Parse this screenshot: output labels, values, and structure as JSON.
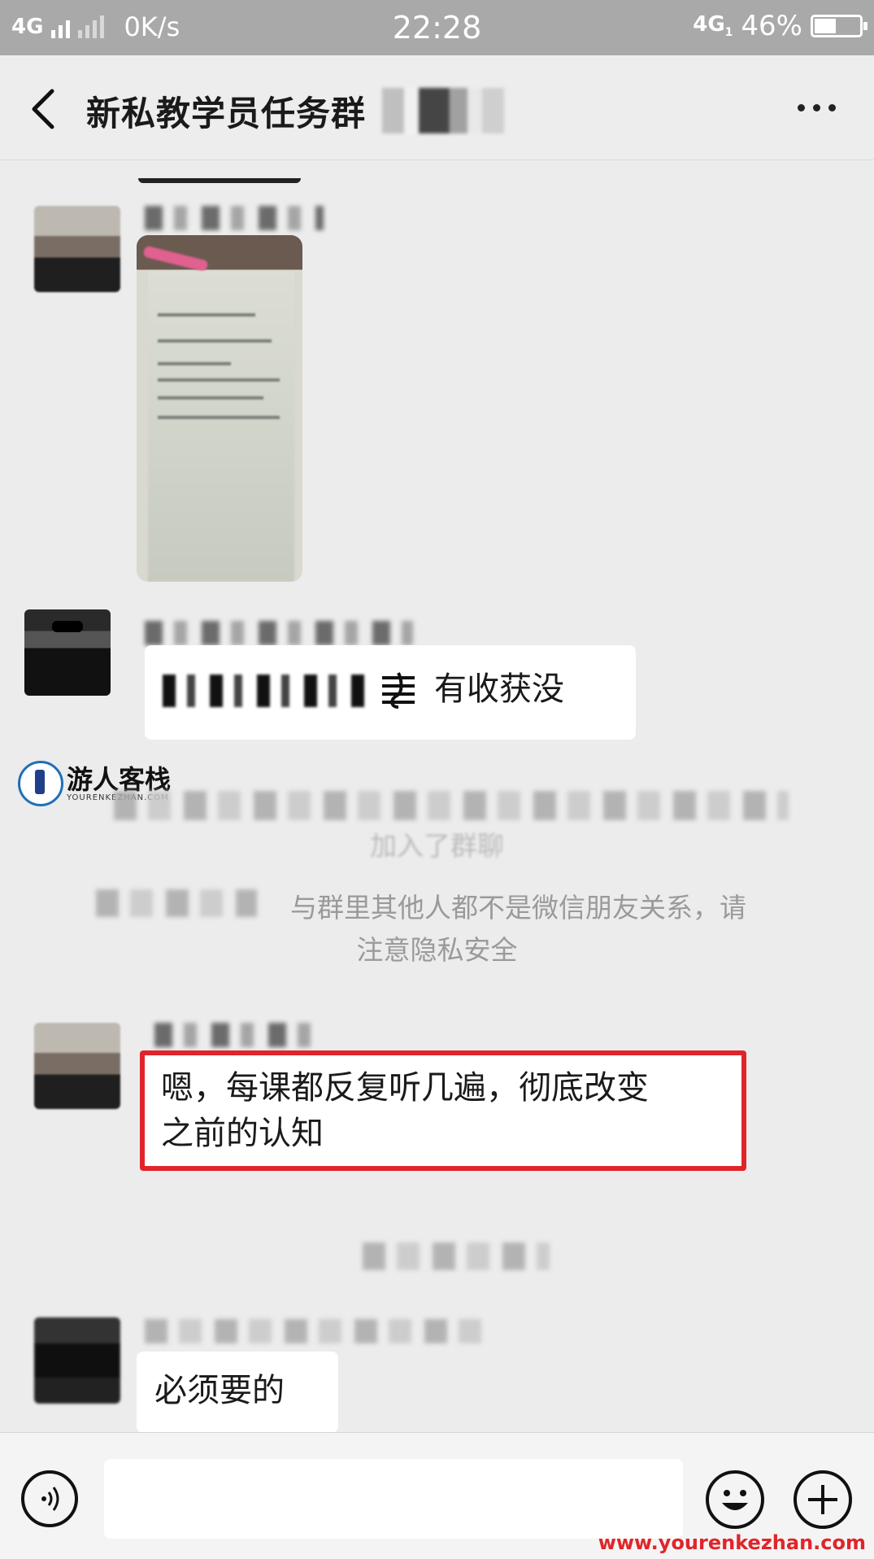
{
  "status_bar": {
    "network_left": "4G",
    "speed": "0K/s",
    "time": "22:28",
    "network_right": "4G",
    "network_right_sub": "1",
    "battery": "46%"
  },
  "nav": {
    "title": "新私教学员任务群"
  },
  "messages": {
    "msg2_text": "有收获没",
    "system_notice_line1": "与群里其他人都不是微信朋友关系，请",
    "system_notice_line2": "注意隐私安全",
    "system_join_partial": "加入了群聊",
    "msg3_line1": "嗯，每课都反复听几遍，彻底改变",
    "msg3_line2": "之前的认知",
    "msg4_text": "必须要的"
  },
  "watermark": {
    "logo_name": "游人客栈",
    "logo_sub": "YOURENKEZHAN.COM",
    "site": "www.yourenkezhan.com"
  },
  "colors": {
    "highlight_border": "#e0252a",
    "status_bar_bg": "#a9a9a9",
    "chat_bg": "#ececec"
  },
  "icons": {
    "back": "chevron-left-icon",
    "more": "more-dots-icon",
    "voice": "voice-icon",
    "emoji": "emoji-icon",
    "plus": "plus-icon",
    "note": "music-note-icon"
  }
}
